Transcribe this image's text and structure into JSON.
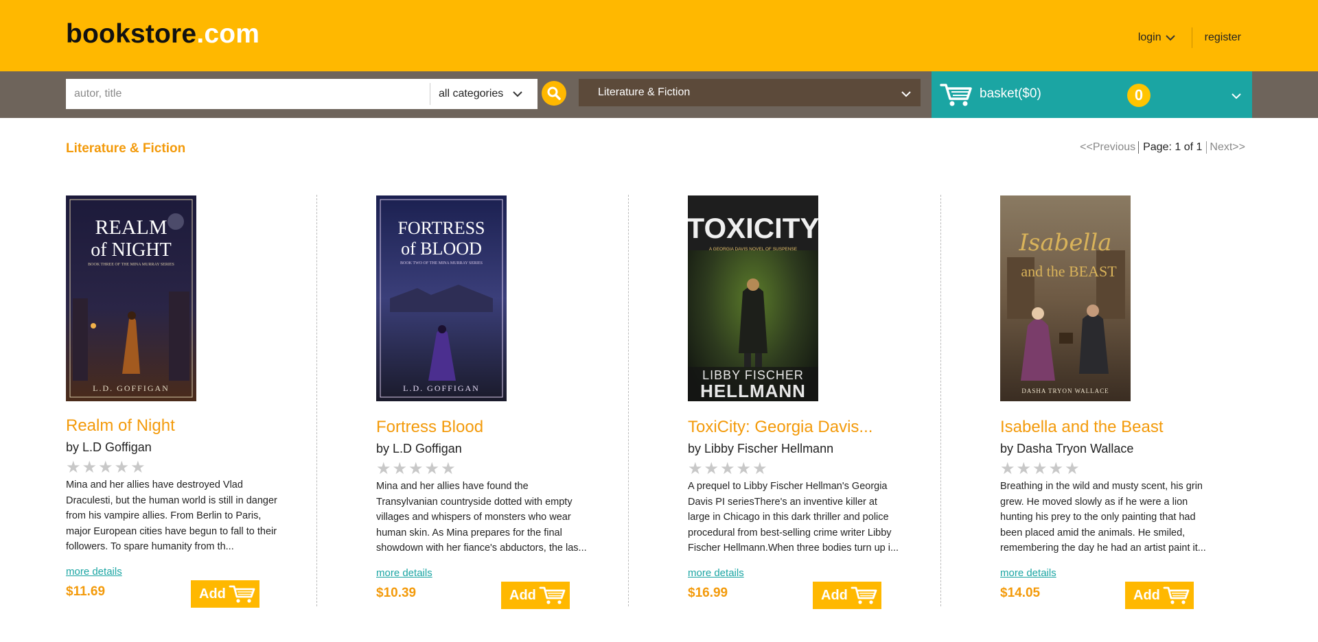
{
  "header": {
    "logo_main": "bookstore",
    "logo_suffix": ".com",
    "login_label": "login",
    "register_label": "register"
  },
  "search": {
    "placeholder": "autor, title",
    "value": "",
    "category_selected": "all categories"
  },
  "genre": {
    "selected": "Literature & Fiction"
  },
  "basket": {
    "label": "basket($0)",
    "count": "0"
  },
  "section": {
    "title": "Literature & Fiction"
  },
  "pager": {
    "prev": "<<Previous",
    "page": "Page: 1 of 1",
    "next": "Next>>"
  },
  "products": [
    {
      "title": "Realm of Night",
      "author": "by L.D Goffigan",
      "rating": 0,
      "description": "Mina and her allies have destroyed Vlad Draculesti, but the human world is still in danger from his vampire allies. From Berlin to Paris, major European cities have begun to fall to their followers. To spare humanity from th...",
      "more": "more details",
      "price": "$11.69",
      "add": "Add",
      "cover": {
        "title_line1": "REALM",
        "title_line2": "of NIGHT",
        "subtitle": "BOOK THREE OF THE MINA MURRAY SERIES",
        "author": "L.D. GOFFIGAN"
      }
    },
    {
      "title": "Fortress Blood",
      "author": "by L.D Goffigan",
      "rating": 0,
      "description": "Mina and her allies have found the Transylvanian countryside dotted with empty villages and whispers of monsters who wear human skin. As Mina prepares for the final showdown with her fiance's abductors, the las...",
      "more": "more details",
      "price": "$10.39",
      "add": "Add",
      "cover": {
        "title_line1": "FORTRESS",
        "title_line2": "of BLOOD",
        "subtitle": "BOOK TWO OF THE MINA MURRAY SERIES",
        "author": "L.D. GOFFIGAN"
      }
    },
    {
      "title": "ToxiCity: Georgia Davis...",
      "author": "by Libby Fischer Hellmann",
      "rating": 0,
      "description": "A prequel to Libby Fischer Hellman's Georgia Davis PI seriesThere's an inventive killer at large in Chicago in this dark thriller and police procedural from best-selling crime writer Libby Fischer Hellmann.When three bodies turn up i...",
      "more": "more details",
      "price": "$16.99",
      "add": "Add",
      "cover": {
        "title_line1": "TOXICITY",
        "subtitle": "A GEORGIA DAVIS NOVEL OF SUSPENSE",
        "author_line1": "LIBBY FISCHER",
        "author_line2": "HELLMANN"
      }
    },
    {
      "title": "Isabella and the Beast",
      "author": "by Dasha Tryon Wallace",
      "rating": 0,
      "description": "Breathing in the wild and musty scent, his grin grew. He moved slowly as if he were a lion hunting his prey to the only painting that had been placed amid the animals. He smiled, remembering the day he had an artist paint it...",
      "more": "more details",
      "price": "$14.05",
      "add": "Add",
      "cover": {
        "title_line1": "Isabella",
        "title_line2": "and the BEAST",
        "author": "DASHA TRYON WALLACE"
      }
    }
  ],
  "colors": {
    "header_bg": "#FFB800",
    "search_row_bg": "#6E645B",
    "genre_bg": "#5C4A3A",
    "basket_bg": "#1BA5A3",
    "accent_orange": "#F39A0A",
    "link_teal": "#1BA5A3"
  },
  "icons": {
    "login_chevron": "chevron-down-icon",
    "search": "search-icon",
    "cart": "cart-icon",
    "star": "star-icon"
  }
}
